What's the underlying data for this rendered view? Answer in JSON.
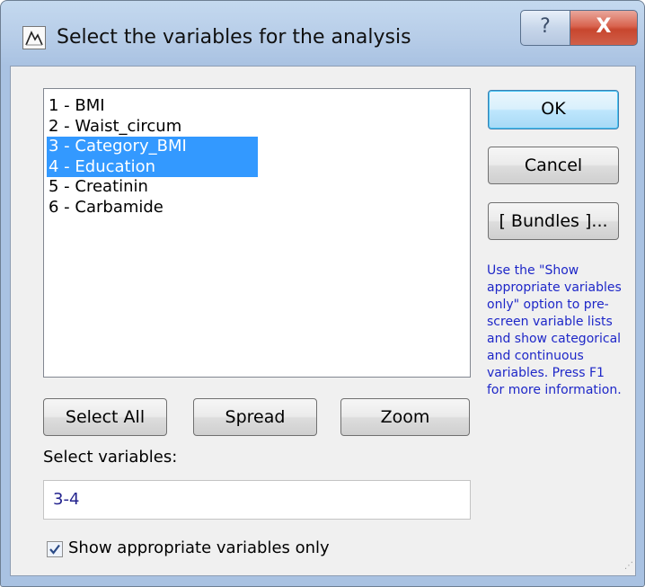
{
  "window": {
    "title": "Select the variables for the analysis",
    "help_label": "?",
    "close_label": "X"
  },
  "variables_list": [
    {
      "label": "1 - BMI",
      "selected": false
    },
    {
      "label": "2 - Waist_circum",
      "selected": false
    },
    {
      "label": "3 - Category_BMI",
      "selected": true
    },
    {
      "label": "4 - Education",
      "selected": true
    },
    {
      "label": "5 - Creatinin",
      "selected": false
    },
    {
      "label": "6 - Carbamide",
      "selected": false
    }
  ],
  "buttons": {
    "ok": "OK",
    "cancel": "Cancel",
    "bundles": "[ Bundles ]...",
    "select_all": "Select All",
    "spread": "Spread",
    "zoom": "Zoom"
  },
  "info_text": "Use the \"Show appropriate variables only\" option to pre-screen variable lists and show categorical and continuous variables. Press F1 for more information.",
  "select_variables": {
    "label": "Select variables:",
    "value": "3-4"
  },
  "show_appropriate": {
    "label": "Show appropriate variables only",
    "checked": true
  },
  "colors": {
    "selection": "#3399ff",
    "info_text": "#1e27c8",
    "close_button": "#c8462e"
  }
}
